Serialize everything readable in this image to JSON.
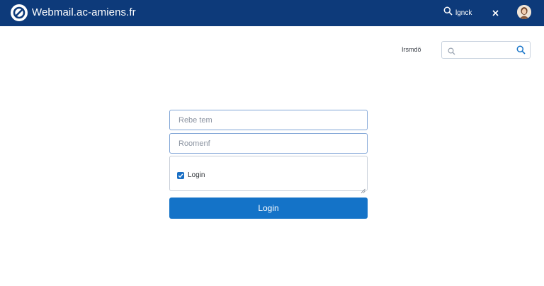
{
  "header": {
    "title": "Webmail.ac-amiens.fr",
    "logo_icon": "no-entry-circle-icon",
    "search_label": "lgnck",
    "search_icon": "search-icon",
    "close_icon": "close-icon",
    "avatar_icon": "user-avatar-icon",
    "background_color": "#0d3a7a"
  },
  "utility": {
    "label": "Irsmdö",
    "search_placeholder": "",
    "search_icon": "search-icon"
  },
  "form": {
    "username_placeholder": "Rebe tem",
    "password_placeholder": "Roomenf",
    "remember_checked": true,
    "remember_label": "Login",
    "login_button_label": "Login",
    "accent_color": "#1473c8"
  }
}
